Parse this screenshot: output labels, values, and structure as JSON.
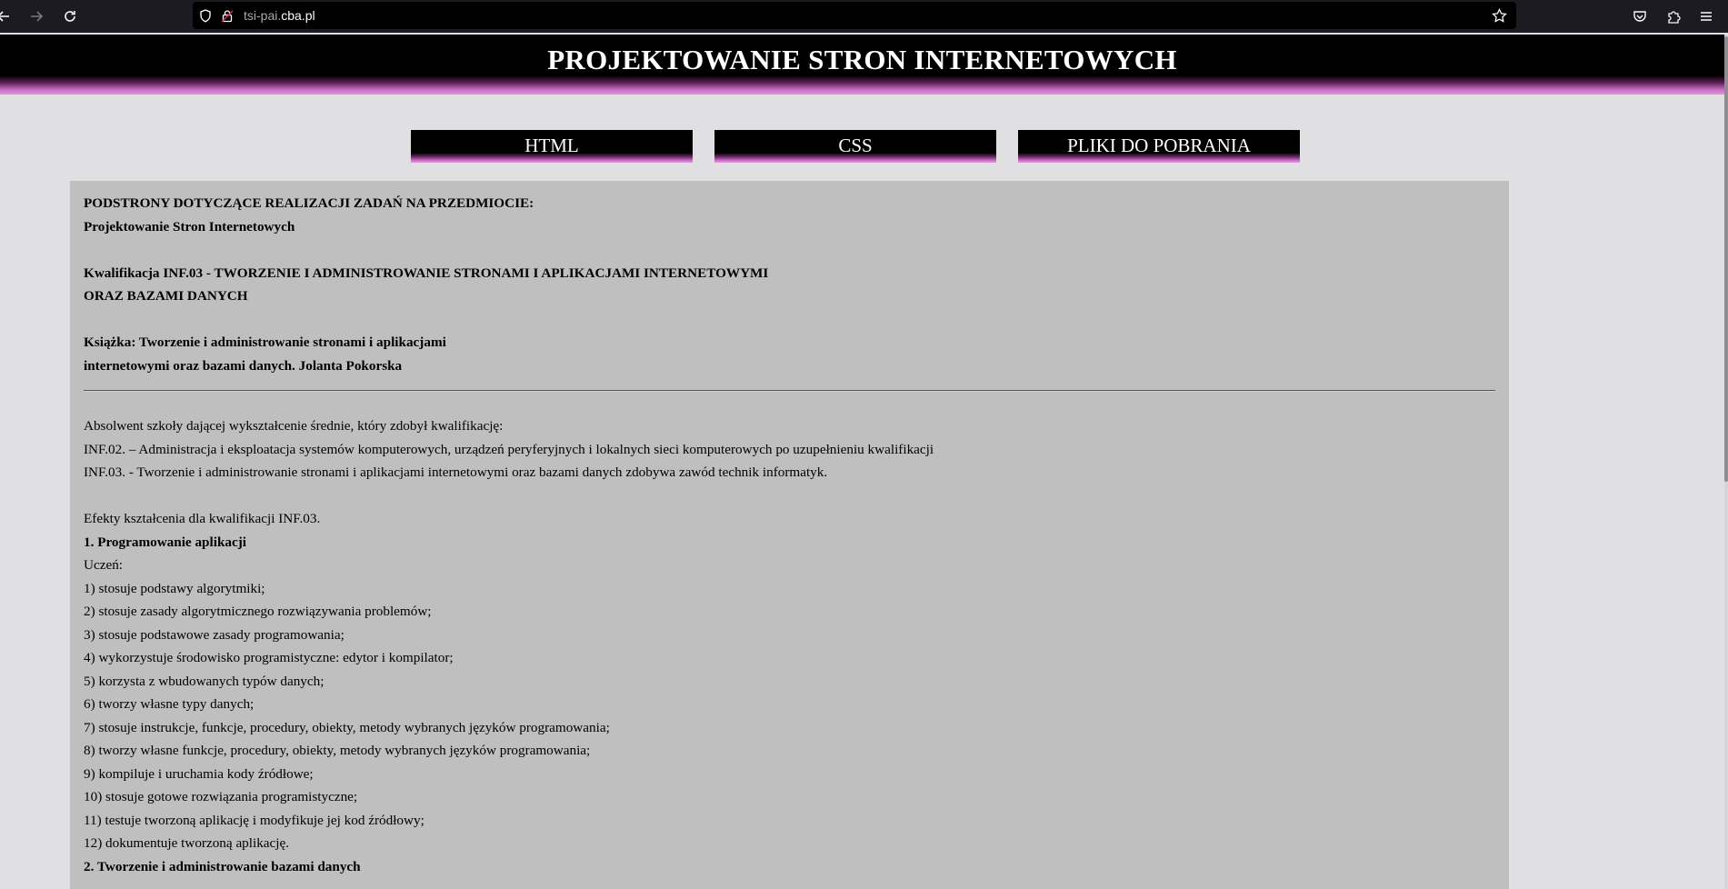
{
  "browser": {
    "url_prefix": "tsi-pai.",
    "url_domain": "cba.pl",
    "icons": {
      "back": "arrow-left-icon",
      "forward": "arrow-right-icon",
      "reload": "reload-icon",
      "shield": "shield-icon",
      "lock": "lock-icon",
      "bookmark": "star-icon",
      "pocket": "pocket-icon",
      "extensions": "puzzle-icon",
      "menu": "hamburger-menu-icon"
    }
  },
  "site": {
    "title": "PROJEKTOWANIE STRON INTERNETOWYCH",
    "menu": [
      {
        "label": "HTML"
      },
      {
        "label": "CSS"
      },
      {
        "label": "PLIKI DO POBRANIA"
      }
    ]
  },
  "content": {
    "intro": [
      "PODSTRONY DOTYCZĄCE REALIZACJI ZADAŃ NA PRZEDMIOCIE:",
      "Projektowanie Stron Internetowych"
    ],
    "qualification": [
      "Kwalifikacja INF.03 - TWORZENIE I ADMINISTROWANIE STRONAMI I APLIKACJAMI INTERNETOWYMI",
      "ORAZ BAZAMI DANYCH"
    ],
    "book": [
      "Książka: Tworzenie i administrowanie stronami i aplikacjami",
      "internetowymi oraz bazami danych. Jolanta Pokorska"
    ],
    "graduate": [
      "Absolwent szkoły dającej wykształcenie średnie, który zdobył kwalifikację:",
      "INF.02. – Administracja i eksploatacja systemów komputerowych, urządzeń peryferyjnych i lokalnych sieci komputerowych po uzupełnieniu kwalifikacji",
      "INF.03. - Tworzenie i administrowanie stronami i aplikacjami internetowymi oraz bazami danych zdobywa zawód technik informatyk."
    ],
    "effects_title": "Efekty kształcenia dla kwalifikacji INF.03.",
    "section1_title": "1. Programowanie aplikacji",
    "student": "Uczeń:",
    "items": [
      "1) stosuje podstawy algorytmiki;",
      "2) stosuje zasady algorytmicznego rozwiązywania problemów;",
      "3) stosuje podstawowe zasady programowania;",
      "4) wykorzystuje środowisko programistyczne: edytor i kompilator;",
      "5) korzysta z wbudowanych typów danych;",
      "6) tworzy własne typy danych;",
      "7) stosuje instrukcje, funkcje, procedury, obiekty, metody wybranych języków programowania;",
      "8) tworzy własne funkcje, procedury, obiekty, metody wybranych języków programowania;",
      "9) kompiluje i uruchamia kody źródłowe;",
      "10) stosuje gotowe rozwiązania programistyczne;",
      "11) testuje tworzoną aplikację i modyfikuje jej kod źródłowy;",
      "12) dokumentuje tworzoną aplikację."
    ],
    "section2_title": "2. Tworzenie i administrowanie bazami danych"
  }
}
